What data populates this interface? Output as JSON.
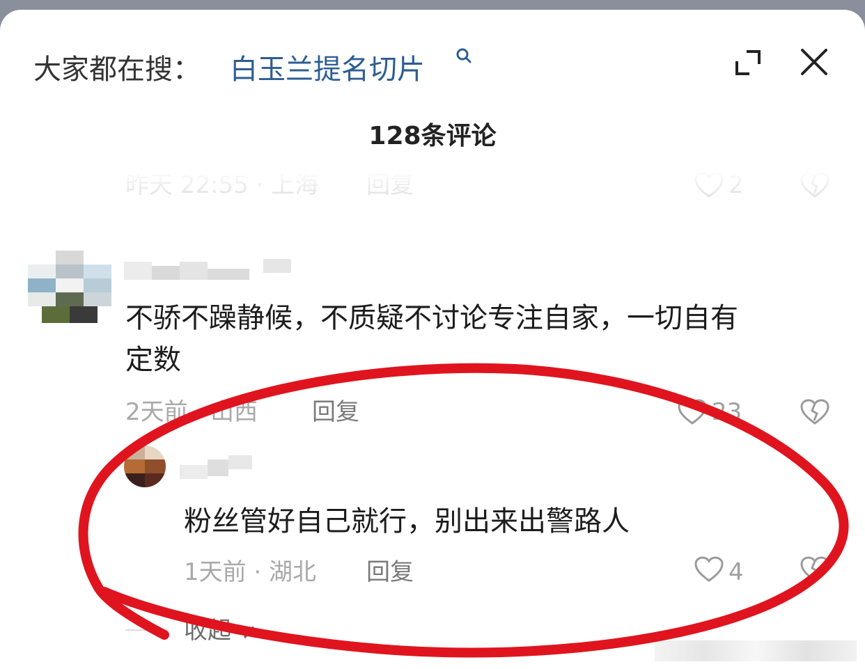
{
  "header": {
    "search_prefix": "大家都在搜：",
    "search_term": "白玉兰提名切片"
  },
  "title": "128条评论",
  "comments": [
    {
      "meta": "昨天 22:55 · 上海",
      "reply": "回复",
      "likes": "2"
    },
    {
      "text_line1": "不骄不躁静候，不质疑不讨论专注自家，一切自有",
      "text_line2": "定数",
      "meta": "2天前 · 山西",
      "reply": "回复",
      "likes": "23"
    },
    {
      "text": "粉丝管好自己就行，别出来出警路人",
      "meta": "1天前 · 湖北",
      "reply": "回复",
      "likes": "4"
    }
  ],
  "collapse_label": "收起",
  "colors": {
    "link": "#2d5d93",
    "annotation": "#e0141e"
  },
  "icons": [
    "search-icon",
    "expand-icon",
    "close-icon",
    "heart-icon",
    "broken-heart-icon",
    "chevron-up-icon"
  ]
}
